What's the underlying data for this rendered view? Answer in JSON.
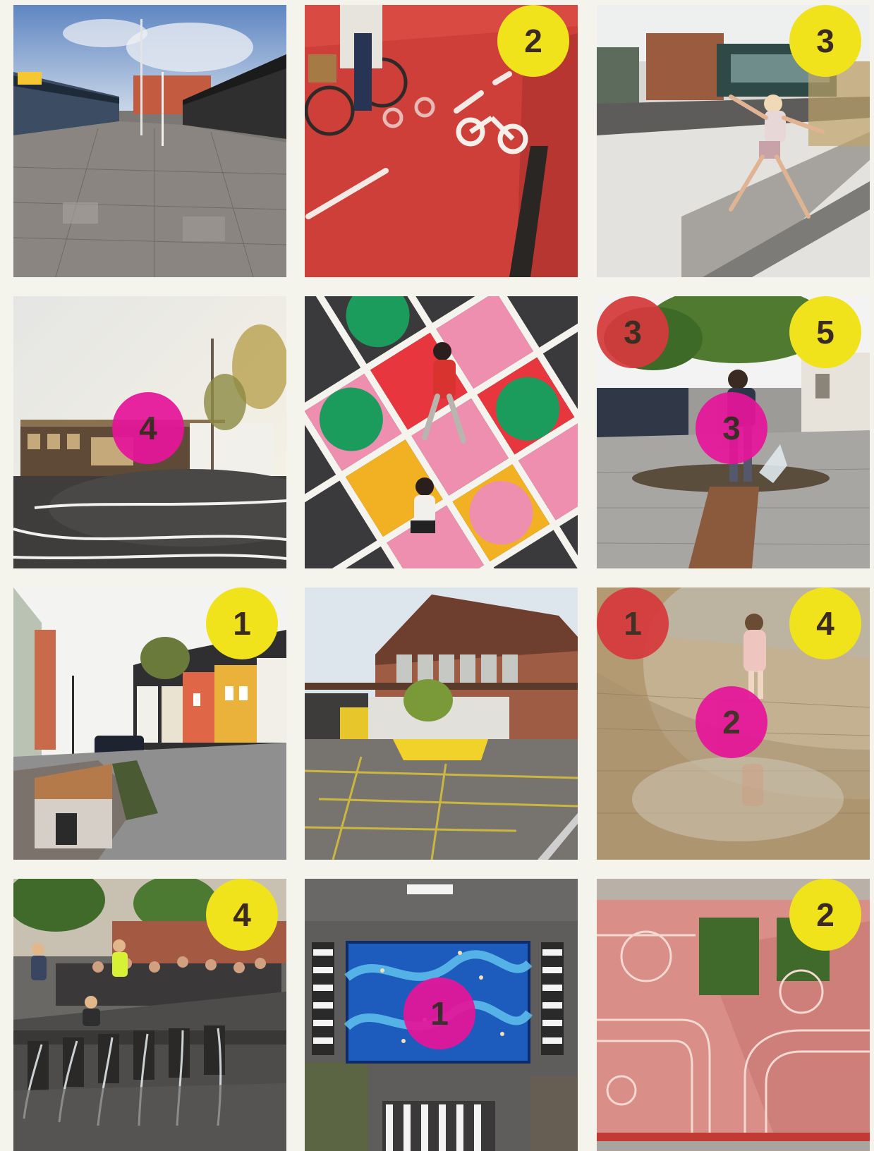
{
  "colors": {
    "background": "#f4f3ec",
    "yellow_badge": "#f0e21b",
    "red_badge": "#d63a3c",
    "magenta_badge": "#e6159a"
  },
  "tiles": [
    {
      "scene": "pedestrian-street-with-shops",
      "badges": []
    },
    {
      "scene": "red-bicycle-lane",
      "badges": [
        {
          "color": "yellow",
          "value": "2"
        }
      ]
    },
    {
      "scene": "girl-jumping-water-channel",
      "badges": [
        {
          "color": "yellow",
          "value": "3"
        }
      ]
    },
    {
      "scene": "square-with-curved-lines-and-trees",
      "badges": [
        {
          "color": "magenta",
          "value": "4"
        }
      ]
    },
    {
      "scene": "children-on-colorful-painted-pavement",
      "badges": []
    },
    {
      "scene": "boy-at-water-fountain",
      "badges": [
        {
          "color": "red",
          "value": "3"
        },
        {
          "color": "yellow",
          "value": "5"
        },
        {
          "color": "magenta",
          "value": "3"
        }
      ]
    },
    {
      "scene": "street-with-colorful-houses-and-bench",
      "badges": [
        {
          "color": "yellow",
          "value": "1"
        }
      ]
    },
    {
      "scene": "industrial-hall-with-yellow-markings",
      "badges": []
    },
    {
      "scene": "girl-walking-in-shallow-water",
      "badges": [
        {
          "color": "red",
          "value": "1"
        },
        {
          "color": "yellow",
          "value": "4"
        },
        {
          "color": "magenta",
          "value": "2"
        }
      ]
    },
    {
      "scene": "children-at-water-fountain-steps",
      "badges": [
        {
          "color": "yellow",
          "value": "4"
        }
      ]
    },
    {
      "scene": "aerial-blue-painted-crossing",
      "badges": [
        {
          "color": "magenta",
          "value": "1"
        }
      ]
    },
    {
      "scene": "aerial-pink-playground",
      "badges": [
        {
          "color": "yellow",
          "value": "2"
        }
      ]
    }
  ]
}
